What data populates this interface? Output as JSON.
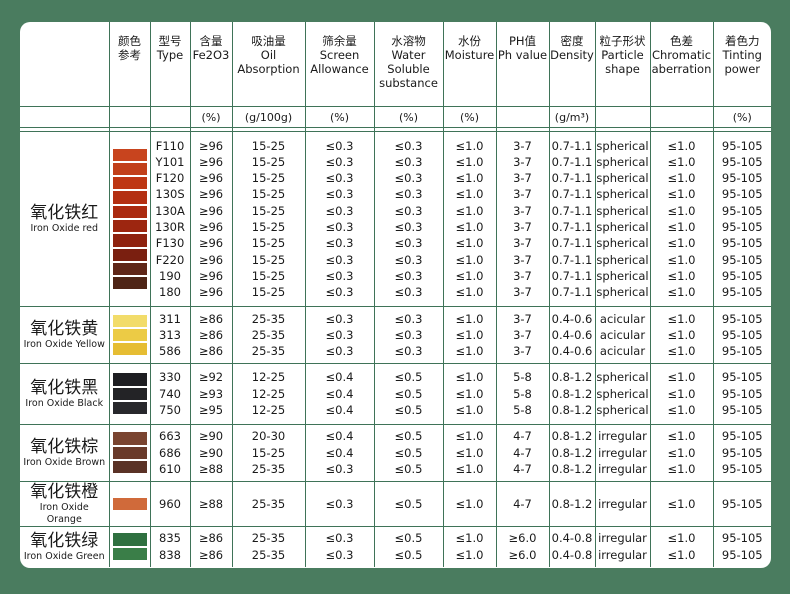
{
  "headers": [
    {
      "zh": "",
      "en": ""
    },
    {
      "zh": "颜色",
      "en": "参考"
    },
    {
      "zh": "型号",
      "en": "Type"
    },
    {
      "zh": "含量",
      "en": "Fe2O3"
    },
    {
      "zh": "吸油量",
      "en": "Oil Absorption"
    },
    {
      "zh": "筛余量",
      "en": "Screen Allowance"
    },
    {
      "zh": "水溶物",
      "en": "Water Soluble substance"
    },
    {
      "zh": "水份",
      "en": "Moisture"
    },
    {
      "zh": "PH值",
      "en": "Ph value"
    },
    {
      "zh": "密度",
      "en": "Density"
    },
    {
      "zh": "粒子形状",
      "en": "Particle shape"
    },
    {
      "zh": "色差",
      "en": "Chromatic aberration"
    },
    {
      "zh": "着色力",
      "en": "Tinting power"
    }
  ],
  "units": [
    "",
    "",
    "",
    "(%)",
    "(g/100g)",
    "(%)",
    "(%)",
    "(%)",
    "",
    "(g/m³)",
    "",
    "",
    "(%)"
  ],
  "groups": [
    {
      "name_zh": "氧化铁红",
      "name_en": "Iron Oxide red",
      "colors": [
        "#c8441e",
        "#c23f1a",
        "#be3614",
        "#b42f12",
        "#ab2a10",
        "#9d2610",
        "#8f220f",
        "#7a1f10",
        "#5f2618",
        "#4e2416"
      ],
      "types": [
        "F110",
        "Y101",
        "F120",
        "130S",
        "130A",
        "130R",
        "F130",
        "F220",
        "190",
        "180"
      ],
      "fe2o3": [
        "≥96",
        "≥96",
        "≥96",
        "≥96",
        "≥96",
        "≥96",
        "≥96",
        "≥96",
        "≥96",
        "≥96"
      ],
      "oil": [
        "15-25",
        "15-25",
        "15-25",
        "15-25",
        "15-25",
        "15-25",
        "15-25",
        "15-25",
        "15-25",
        "15-25"
      ],
      "screen": [
        "≤0.3",
        "≤0.3",
        "≤0.3",
        "≤0.3",
        "≤0.3",
        "≤0.3",
        "≤0.3",
        "≤0.3",
        "≤0.3",
        "≤0.3"
      ],
      "water": [
        "≤0.3",
        "≤0.3",
        "≤0.3",
        "≤0.3",
        "≤0.3",
        "≤0.3",
        "≤0.3",
        "≤0.3",
        "≤0.3",
        "≤0.3"
      ],
      "moisture": [
        "≤1.0",
        "≤1.0",
        "≤1.0",
        "≤1.0",
        "≤1.0",
        "≤1.0",
        "≤1.0",
        "≤1.0",
        "≤1.0",
        "≤1.0"
      ],
      "ph": [
        "3-7",
        "3-7",
        "3-7",
        "3-7",
        "3-7",
        "3-7",
        "3-7",
        "3-7",
        "3-7",
        "3-7"
      ],
      "density": [
        "0.7-1.1",
        "0.7-1.1",
        "0.7-1.1",
        "0.7-1.1",
        "0.7-1.1",
        "0.7-1.1",
        "0.7-1.1",
        "0.7-1.1",
        "0.7-1.1",
        "0.7-1.1"
      ],
      "shape": [
        "spherical",
        "spherical",
        "spherical",
        "spherical",
        "spherical",
        "spherical",
        "spherical",
        "spherical",
        "spherical",
        "spherical"
      ],
      "chromatic": [
        "≤1.0",
        "≤1.0",
        "≤1.0",
        "≤1.0",
        "≤1.0",
        "≤1.0",
        "≤1.0",
        "≤1.0",
        "≤1.0",
        "≤1.0"
      ],
      "tinting": [
        "95-105",
        "95-105",
        "95-105",
        "95-105",
        "95-105",
        "95-105",
        "95-105",
        "95-105",
        "95-105",
        "95-105"
      ]
    },
    {
      "name_zh": "氧化铁黄",
      "name_en": "Iron Oxide Yellow",
      "colors": [
        "#f2dc6a",
        "#eccb45",
        "#e6bd33"
      ],
      "types": [
        "311",
        "313",
        "586"
      ],
      "fe2o3": [
        "≥86",
        "≥86",
        "≥86"
      ],
      "oil": [
        "25-35",
        "25-35",
        "25-35"
      ],
      "screen": [
        "≤0.3",
        "≤0.3",
        "≤0.3"
      ],
      "water": [
        "≤0.3",
        "≤0.3",
        "≤0.3"
      ],
      "moisture": [
        "≤1.0",
        "≤1.0",
        "≤1.0"
      ],
      "ph": [
        "3-7",
        "3-7",
        "3-7"
      ],
      "density": [
        "0.4-0.6",
        "0.4-0.6",
        "0.4-0.6"
      ],
      "shape": [
        "acicular",
        "acicular",
        "acicular"
      ],
      "chromatic": [
        "≤1.0",
        "≤1.0",
        "≤1.0"
      ],
      "tinting": [
        "95-105",
        "95-105",
        "95-105"
      ]
    },
    {
      "name_zh": "氧化铁黑",
      "name_en": "Iron Oxide Black",
      "colors": [
        "#1e1e22",
        "#232326",
        "#28282c"
      ],
      "types": [
        "330",
        "740",
        "750"
      ],
      "fe2o3": [
        "≥92",
        "≥93",
        "≥95"
      ],
      "oil": [
        "12-25",
        "12-25",
        "12-25"
      ],
      "screen": [
        "≤0.4",
        "≤0.4",
        "≤0.4"
      ],
      "water": [
        "≤0.5",
        "≤0.5",
        "≤0.5"
      ],
      "moisture": [
        "≤1.0",
        "≤1.0",
        "≤1.0"
      ],
      "ph": [
        "5-8",
        "5-8",
        "5-8"
      ],
      "density": [
        "0.8-1.2",
        "0.8-1.2",
        "0.8-1.2"
      ],
      "shape": [
        "spherical",
        "spherical",
        "spherical"
      ],
      "chromatic": [
        "≤1.0",
        "≤1.0",
        "≤1.0"
      ],
      "tinting": [
        "95-105",
        "95-105",
        "95-105"
      ]
    },
    {
      "name_zh": "氧化铁棕",
      "name_en": "Iron Oxide Brown",
      "colors": [
        "#7a4430",
        "#6a3a2a",
        "#5a3226"
      ],
      "types": [
        "663",
        "686",
        "610"
      ],
      "fe2o3": [
        "≥90",
        "≥90",
        "≥88"
      ],
      "oil": [
        "20-30",
        "15-25",
        "25-35"
      ],
      "screen": [
        "≤0.4",
        "≤0.4",
        "≤0.3"
      ],
      "water": [
        "≤0.5",
        "≤0.5",
        "≤0.5"
      ],
      "moisture": [
        "≤1.0",
        "≤1.0",
        "≤1.0"
      ],
      "ph": [
        "4-7",
        "4-7",
        "4-7"
      ],
      "density": [
        "0.8-1.2",
        "0.8-1.2",
        "0.8-1.2"
      ],
      "shape": [
        "irregular",
        "irregular",
        "irregular"
      ],
      "chromatic": [
        "≤1.0",
        "≤1.0",
        "≤1.0"
      ],
      "tinting": [
        "95-105",
        "95-105",
        "95-105"
      ]
    },
    {
      "name_zh": "氧化铁橙",
      "name_en": "Iron Oxide Orange",
      "colors": [
        "#d06a3a"
      ],
      "types": [
        "960"
      ],
      "fe2o3": [
        "≥88"
      ],
      "oil": [
        "25-35"
      ],
      "screen": [
        "≤0.3"
      ],
      "water": [
        "≤0.5"
      ],
      "moisture": [
        "≤1.0"
      ],
      "ph": [
        "4-7"
      ],
      "density": [
        "0.8-1.2"
      ],
      "shape": [
        "irregular"
      ],
      "chromatic": [
        "≤1.0"
      ],
      "tinting": [
        "95-105"
      ]
    },
    {
      "name_zh": "氧化铁绿",
      "name_en": "Iron Oxide Green",
      "colors": [
        "#2f7040",
        "#3a7e48"
      ],
      "types": [
        "835",
        "838"
      ],
      "fe2o3": [
        "≥86",
        "≥86"
      ],
      "oil": [
        "25-35",
        "25-35"
      ],
      "screen": [
        "≤0.3",
        "≤0.3"
      ],
      "water": [
        "≤0.5",
        "≤0.5"
      ],
      "moisture": [
        "≤1.0",
        "≤1.0"
      ],
      "ph": [
        "≥6.0",
        "≥6.0"
      ],
      "density": [
        "0.4-0.8",
        "0.4-0.8"
      ],
      "shape": [
        "irregular",
        "irregular"
      ],
      "chromatic": [
        "≤1.0",
        "≤1.0"
      ],
      "tinting": [
        "95-105",
        "95-105"
      ]
    }
  ]
}
